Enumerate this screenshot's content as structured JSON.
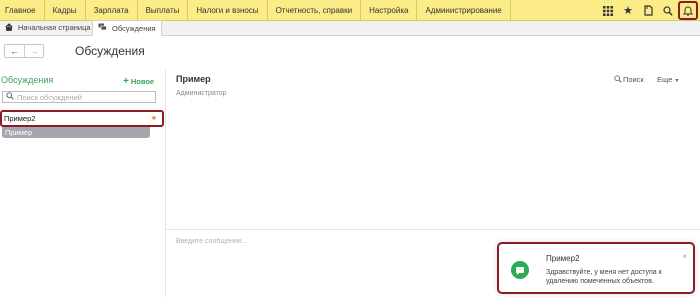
{
  "menubar": {
    "items": [
      {
        "label": "Главное"
      },
      {
        "label": "Кадры"
      },
      {
        "label": "Зарплата"
      },
      {
        "label": "Выплаты"
      },
      {
        "label": "Налоги и взносы"
      },
      {
        "label": "Отчетность, справки"
      },
      {
        "label": "Настройка"
      },
      {
        "label": "Администрирование"
      }
    ],
    "icons": [
      "grid-icon",
      "star-icon",
      "history-icon",
      "search-icon",
      "bell-icon"
    ]
  },
  "tabs": {
    "home": {
      "label": "Начальная страница",
      "icon": "home-icon"
    },
    "discussions": {
      "label": "Обсуждения",
      "icon": "chat-icon"
    }
  },
  "nav": {
    "back": "←",
    "forward": "→"
  },
  "form_title": "Обсуждения",
  "left_pane": {
    "header": "Обсуждения",
    "new_label": "Новое",
    "search_placeholder": "Поиск обсуждений",
    "items": [
      {
        "label": "Пример2",
        "unread": true
      },
      {
        "label": "Пример",
        "selected": true
      }
    ]
  },
  "conversation": {
    "title": "Пример",
    "subtitle": "Администратор",
    "search_label": "Поиск",
    "more_label": "Еще",
    "message_placeholder": "Введите сообщение..."
  },
  "notification": {
    "title": "Пример2",
    "text": "Здравствуйте, у меня нет доступа к удалению помеченных объектов.",
    "close": "×"
  },
  "colors": {
    "menubar_bg": "#fbec88",
    "accent_green": "#3aa55f",
    "highlight_red": "#8a1c28",
    "selected_item_bg": "#a6a6ae"
  }
}
